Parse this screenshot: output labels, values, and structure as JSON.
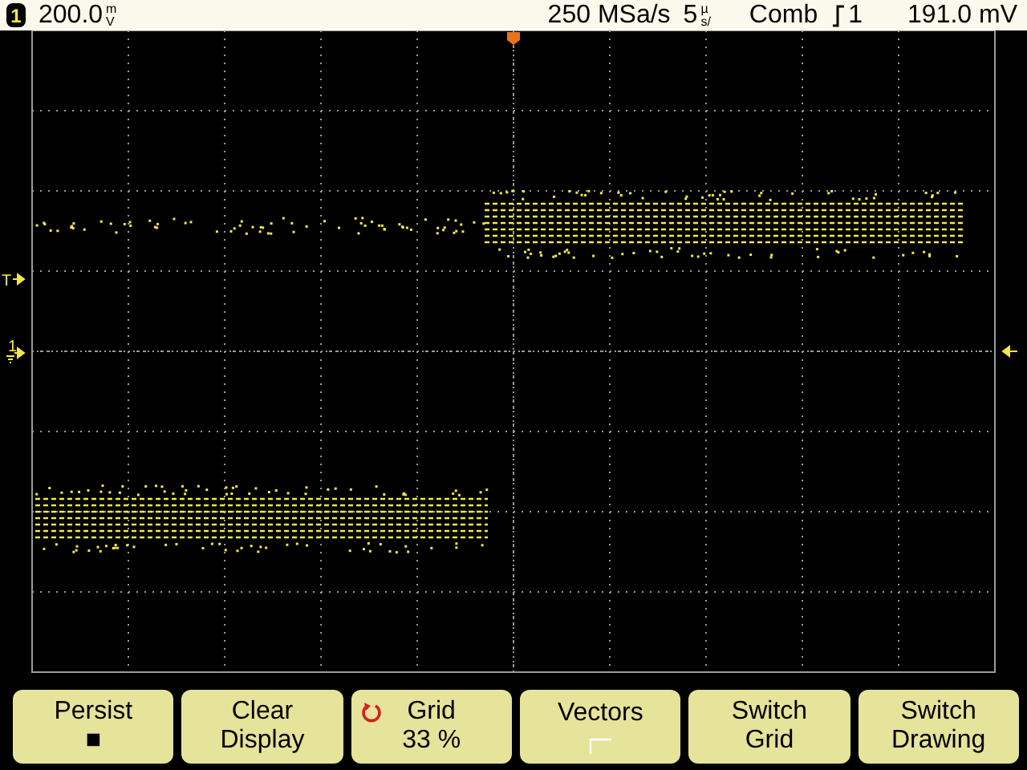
{
  "status_bar": {
    "channel": "1",
    "scale_value": "200.0",
    "scale_unit_top": "m",
    "scale_unit_bottom": "V",
    "sample_rate": "250 MSa/s",
    "time_value": "5",
    "time_unit_top": "µ",
    "time_unit_bottom": "s/",
    "trigger_mode": "Comb",
    "trigger_source": "1",
    "trigger_level": "191.0 mV"
  },
  "display": {
    "trigger_marker": "T",
    "channel_marker": "1"
  },
  "softkeys": [
    {
      "kind": "text",
      "label": "Persist",
      "value": "■"
    },
    {
      "kind": "text",
      "label": "Clear",
      "value": "Display"
    },
    {
      "kind": "knob",
      "label": "Grid",
      "value": "33 %"
    },
    {
      "kind": "vectors",
      "label": "Vectors"
    },
    {
      "kind": "text",
      "label": "Switch",
      "value": "Grid"
    },
    {
      "kind": "text",
      "label": "Switch",
      "value": "Drawing"
    }
  ]
}
